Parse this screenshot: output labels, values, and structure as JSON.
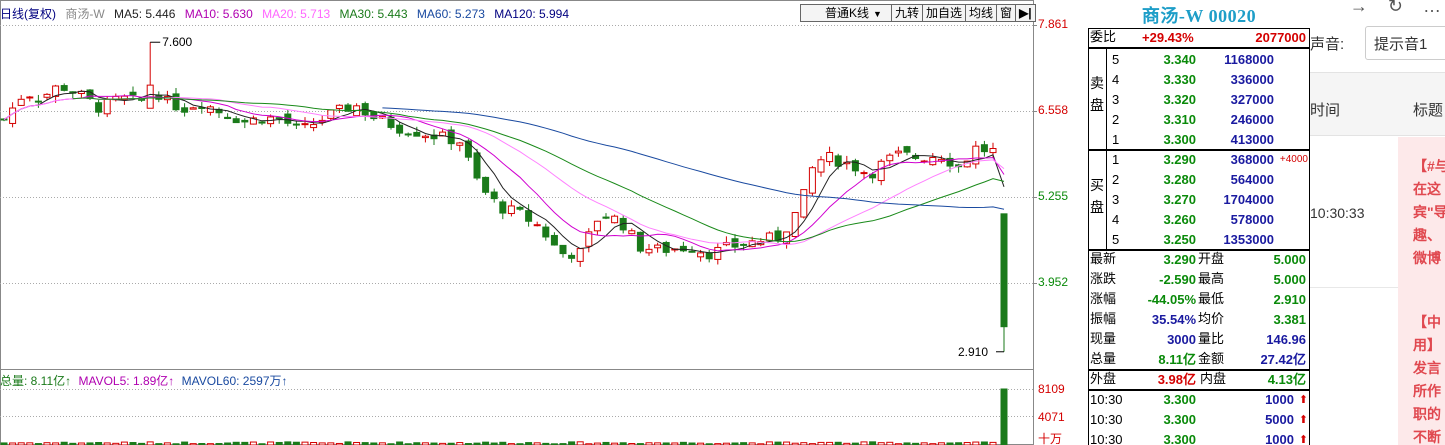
{
  "chart_legend": {
    "period": "日线(复权)",
    "stock_name": "商汤-W",
    "ma5": "MA5: 5.446",
    "ma10": "MA10: 5.630",
    "ma20": "MA20: 5.713",
    "ma30": "MA30: 5.443",
    "ma60": "MA60: 5.273",
    "ma120": "MA120: 5.994"
  },
  "toolbar": {
    "kline_type": "普通K线",
    "jiuzhuan": "九转",
    "add_watch": "加自选",
    "avg_line": "均线",
    "window": "窗",
    "next": "▶|"
  },
  "price_axis": [
    "7.861",
    "6.558",
    "5.255",
    "3.952"
  ],
  "annotations": {
    "high": "7.600",
    "low": "2.910"
  },
  "volume_legend": {
    "total": "总量: 8.11亿↑",
    "mavol5": "MAVOL5: 1.89亿↑",
    "mavol60": "MAVOL60: 2597万↑"
  },
  "volume_axis": [
    "8109",
    "4071",
    "十万"
  ],
  "colors": {
    "up": "#d40000",
    "down": "#1a7a1a",
    "ma5": "#222222",
    "ma10": "#d000d0",
    "ma20": "#ff80ff",
    "ma30": "#1a8a1a",
    "ma60": "#1a4aa0",
    "ma120": "#000080"
  },
  "quote": {
    "title": "商汤-W 00020",
    "weibi_label": "委比",
    "weibi_pct": "+29.43%",
    "weibi_vol": "2077000",
    "sell_label": "卖盘",
    "buy_label": "买盘",
    "sell": [
      {
        "level": "5",
        "price": "3.340",
        "vol": "1168000"
      },
      {
        "level": "4",
        "price": "3.330",
        "vol": "336000"
      },
      {
        "level": "3",
        "price": "3.320",
        "vol": "327000"
      },
      {
        "level": "2",
        "price": "3.310",
        "vol": "246000"
      },
      {
        "level": "1",
        "price": "3.300",
        "vol": "413000"
      }
    ],
    "buy": [
      {
        "level": "1",
        "price": "3.290",
        "vol": "368000",
        "delta": "+4000"
      },
      {
        "level": "2",
        "price": "3.280",
        "vol": "564000"
      },
      {
        "level": "3",
        "price": "3.270",
        "vol": "1704000"
      },
      {
        "level": "4",
        "price": "3.260",
        "vol": "578000"
      },
      {
        "level": "5",
        "price": "3.250",
        "vol": "1353000"
      }
    ],
    "stats": [
      {
        "l1": "最新",
        "v1": "3.290",
        "l2": "开盘",
        "v2": "5.000"
      },
      {
        "l1": "涨跌",
        "v1": "-2.590",
        "l2": "最高",
        "v2": "5.000"
      },
      {
        "l1": "涨幅",
        "v1": "-44.05%",
        "l2": "最低",
        "v2": "2.910"
      },
      {
        "l1": "振幅",
        "v1": "35.54%",
        "l2": "均价",
        "v2": "3.381"
      },
      {
        "l1": "现量",
        "v1": "3000",
        "l2": "量比",
        "v2": "146.96"
      },
      {
        "l1": "总量",
        "v1": "8.11亿",
        "l2": "金额",
        "v2": "27.42亿"
      }
    ],
    "outer_label": "外盘",
    "outer_val": "3.98亿",
    "inner_label": "内盘",
    "inner_val": "4.13亿",
    "ticks": [
      {
        "time": "10:30",
        "price": "3.300",
        "vol": "1000"
      },
      {
        "time": "10:30",
        "price": "3.300",
        "vol": "5000"
      },
      {
        "time": "10:30",
        "price": "3.300",
        "vol": "1000"
      }
    ]
  },
  "web": {
    "voice_label": "声音:",
    "voice_select": "提示音1",
    "col_time": "时间",
    "col_title": "标题",
    "row_time": "10:30:33",
    "news1": [
      "【#与",
      "在这",
      "宾\"导",
      "趣、",
      "微博"
    ],
    "news2": [
      "【中",
      "用】",
      "发言",
      "所作",
      "职的",
      "不断"
    ]
  }
}
